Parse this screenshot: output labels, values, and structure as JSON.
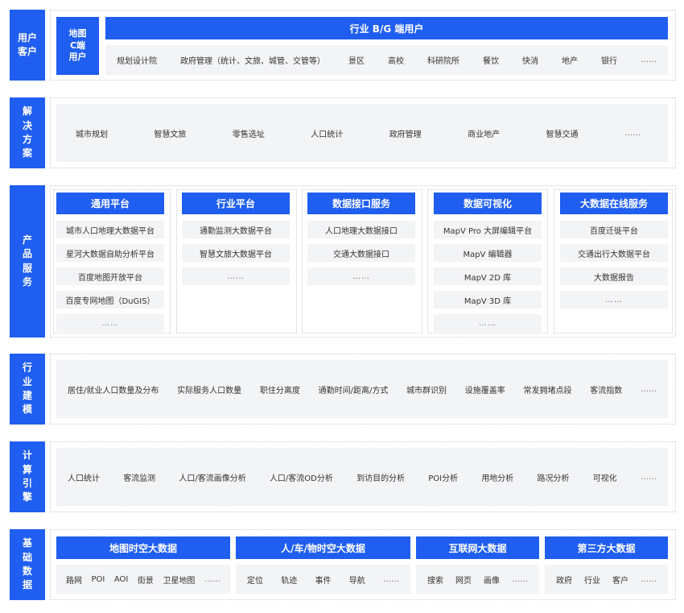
{
  "colors": {
    "primary_blue": "#1f5ef0",
    "panel_gray": "#f3f4f6",
    "dotted_border": "#c8ccd4"
  },
  "rows": {
    "users": {
      "label": "用户\n客户",
      "c_end": "地图\nC端\n用户",
      "industry_header": "行业 B/G 端用户",
      "industry_items": [
        "规划设计院",
        "政府管理（统计、文旅、城管、交管等）",
        "景区",
        "高校",
        "科研院所",
        "餐饮",
        "快消",
        "地产",
        "银行",
        "……"
      ]
    },
    "solutions": {
      "label": "解\n决\n方\n案",
      "items": [
        "城市规划",
        "智慧文旅",
        "零售选址",
        "人口统计",
        "政府管理",
        "商业地产",
        "智慧交通",
        "……"
      ]
    },
    "products": {
      "label": "产\n品\n服\n务",
      "columns": [
        {
          "header": "通用平台",
          "items": [
            "城市人口地理大数据平台",
            "星河大数据自助分析平台",
            "百度地图开放平台",
            "百度专网地图（DuGIS）",
            "……"
          ]
        },
        {
          "header": "行业平台",
          "items": [
            "通勤监测大数据平台",
            "智慧文旅大数据平台",
            "……"
          ]
        },
        {
          "header": "数据接口服务",
          "items": [
            "人口地理大数据接口",
            "交通大数据接口",
            "……"
          ]
        },
        {
          "header": "数据可视化",
          "items": [
            "MapV Pro 大屏编辑平台",
            "MapV 编辑器",
            "MapV 2D 库",
            "MapV 3D 库",
            "……"
          ]
        },
        {
          "header": "大数据在线服务",
          "items": [
            "百度迁徙平台",
            "交通出行大数据平台",
            "大数据报告",
            "……"
          ]
        }
      ]
    },
    "modeling": {
      "label": "行\n业\n建\n模",
      "items": [
        "居住/就业人口数量及分布",
        "实际服务人口数量",
        "职住分离度",
        "通勤时间/距离/方式",
        "城市群识别",
        "设施覆盖率",
        "常发拥堵点段",
        "客流指数",
        "……"
      ]
    },
    "engine": {
      "label": "计\n算\n引\n擎",
      "items": [
        "人口统计",
        "客流监测",
        "人口/客流画像分析",
        "人口/客流OD分析",
        "到访目的分析",
        "POI分析",
        "用地分析",
        "路况分析",
        "可视化",
        "……"
      ]
    },
    "base": {
      "label": "基\n础\n数\n据",
      "groups": [
        {
          "header": "地图时空大数据",
          "items": [
            "路网",
            "POI",
            "AOI",
            "街景",
            "卫星地图",
            "……"
          ]
        },
        {
          "header": "人/车/物时空大数据",
          "items": [
            "定位",
            "轨迹",
            "事件",
            "导航",
            "……"
          ]
        },
        {
          "header": "互联网大数据",
          "items": [
            "搜索",
            "网页",
            "画像",
            "……"
          ]
        },
        {
          "header": "第三方大数据",
          "items": [
            "政府",
            "行业",
            "客户",
            "……"
          ]
        }
      ]
    }
  }
}
